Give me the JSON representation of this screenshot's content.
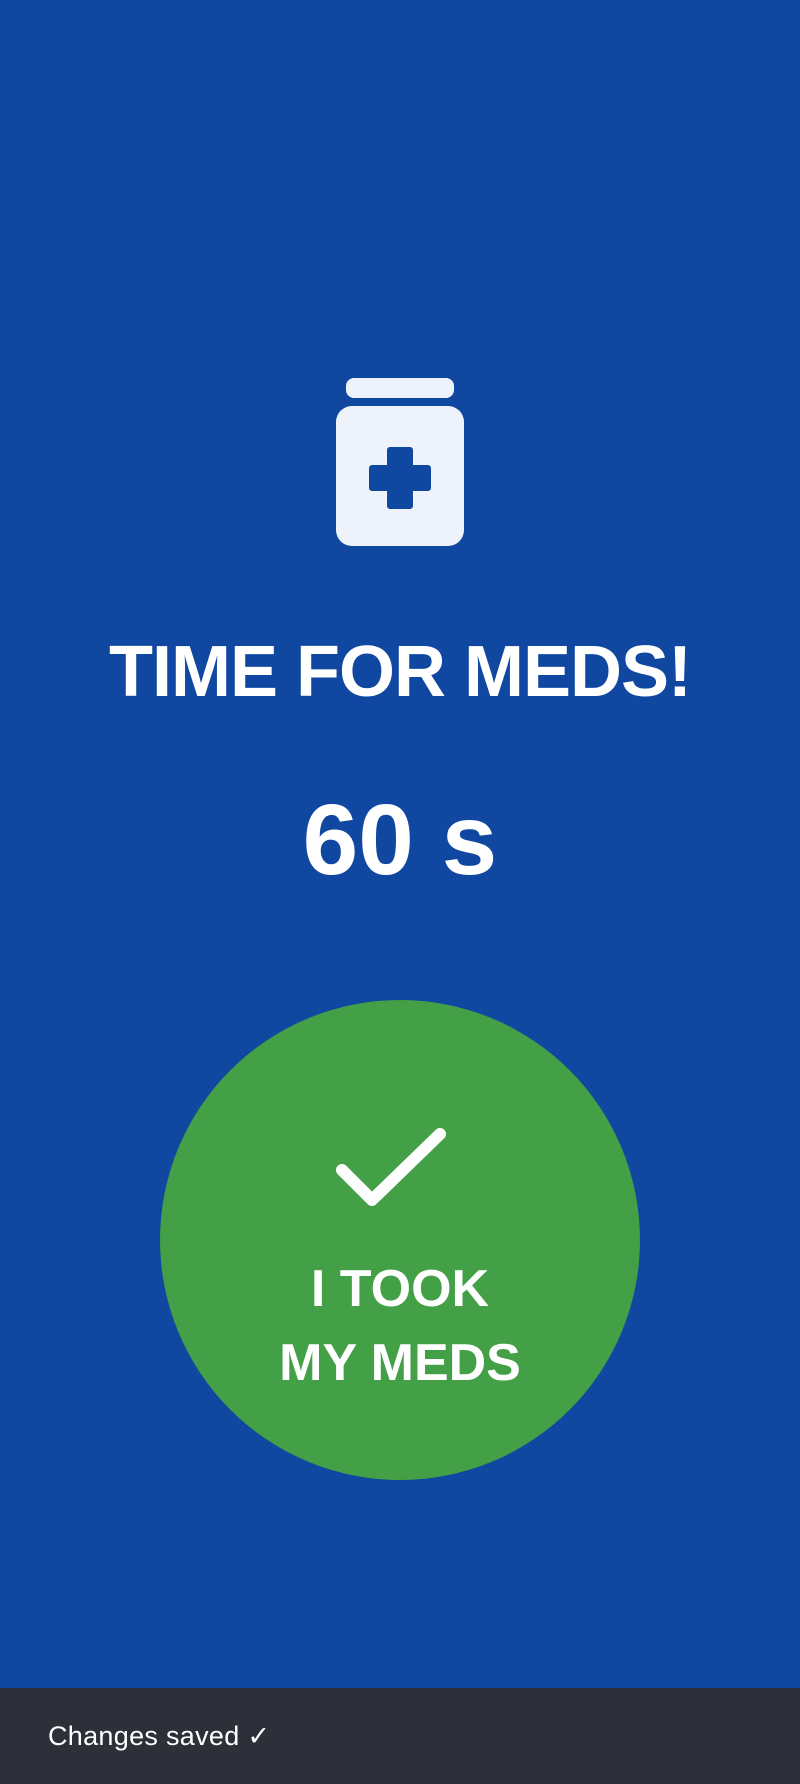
{
  "alert": {
    "title": "TIME FOR MEDS!",
    "countdown": "60 s"
  },
  "action_button": {
    "line1": "I TOOK",
    "line2": "MY MEDS",
    "icon": "checkmark-icon"
  },
  "header_icon": "medicine-bottle-icon",
  "snackbar": {
    "message": "Changes saved ✓"
  },
  "colors": {
    "background": "#0f47a1",
    "button": "#43a047",
    "snackbar": "#2d3038",
    "text": "#ffffff"
  }
}
